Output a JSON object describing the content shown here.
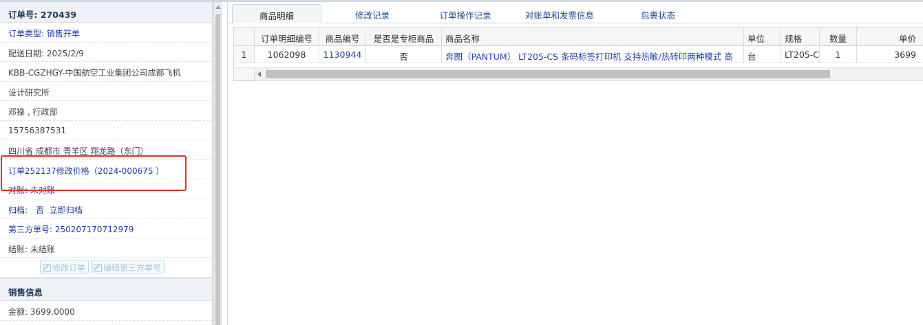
{
  "order": {
    "number_label": "订单号: 270439",
    "type_label": "订单类型: 销售开单",
    "delivery_date": "配送日期: 2025/2/9",
    "customer_line1": "KBB-CGZHGY-中国航空工业集团公司成都飞机",
    "customer_line2": "设计研究所",
    "contact": "邓操 , 行政部",
    "phone": "15756387531",
    "address": "四川省 成都市 青羊区 翔龙路（东门）",
    "price_change_link": "订单252137修改价格（2024-000675 ）",
    "reconcile_status": "对账: 未对账",
    "archive_label": "归档:",
    "archive_value": "否",
    "archive_action": "立即归档",
    "third_party_no": "第三方单号: 250207170712979",
    "settle_status": "结账: 未结账",
    "edit_order_btn": "修改订单",
    "edit_third_party_btn": "编辑第三方单号"
  },
  "sales": {
    "header": "销售信息",
    "amount": "金额: 3699.0000"
  },
  "tabs": [
    "商品明细",
    "修改记录",
    "订单操作记录",
    "对账单和发票信息",
    "包裹状态"
  ],
  "table": {
    "columns": [
      "订单明细编号",
      "商品编号",
      "是否是专柜商品",
      "商品名称",
      "单位",
      "规格",
      "数量",
      "单价"
    ],
    "rows": [
      {
        "index": "1",
        "detail_no": "1062098",
        "product_no": "1130944",
        "is_counter": "否",
        "name": "奔图（PANTUM） LT205-CS 条码标签打印机 支持热敏/热转印两种模式 高",
        "unit": "台",
        "spec": "LT205-C",
        "qty": "1",
        "price": "3699"
      }
    ]
  }
}
